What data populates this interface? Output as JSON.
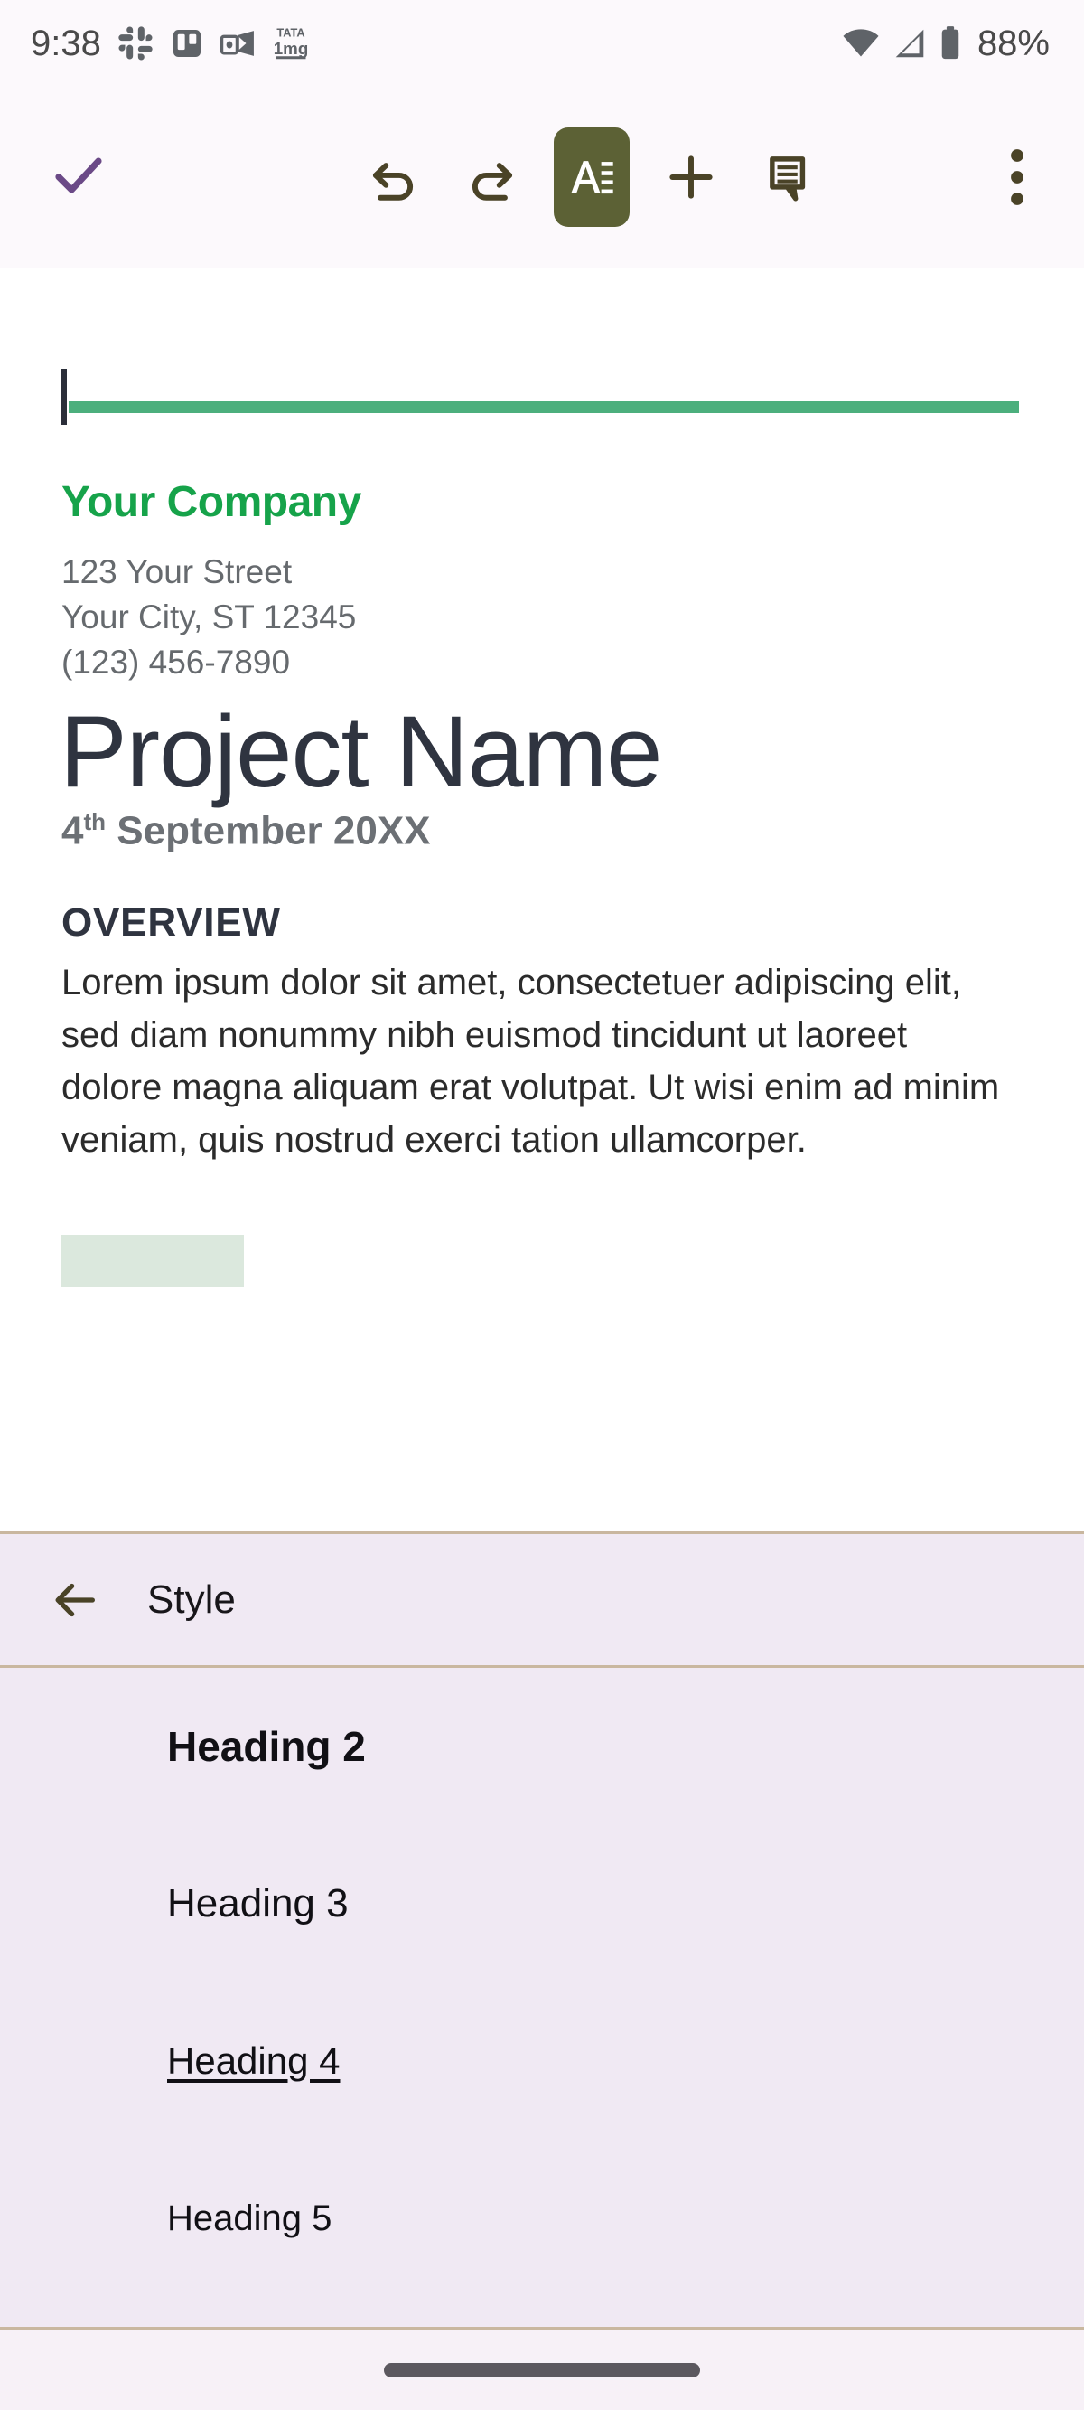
{
  "status_bar": {
    "time": "9:38",
    "battery_percent": "88%",
    "app_icons": [
      "slack-icon",
      "trello-icon",
      "outlook-icon",
      "tata-1mg-icon"
    ],
    "right_icons": [
      "wifi-icon",
      "cellular-signal-icon",
      "battery-icon"
    ]
  },
  "toolbar": {
    "done_label": "done-check",
    "undo_label": "undo",
    "redo_label": "redo",
    "format_label": "format-text",
    "add_label": "add",
    "comment_label": "comment",
    "more_label": "more-options",
    "accent_color": "#5c6135",
    "check_color": "#6b4a87",
    "icon_color": "#4a4327"
  },
  "document": {
    "rule_color": "#4caf7d",
    "company_name": "Your Company",
    "company_color": "#16a34a",
    "address_line_1": "123 Your Street",
    "address_line_2": "Your City, ST 12345",
    "address_line_3": "(123) 456-7890",
    "project_title": "Project Name",
    "date_day": "4",
    "date_ordinal": "th",
    "date_rest": " September 20XX",
    "section_heading": "OVERVIEW",
    "body_text": "Lorem ipsum dolor sit amet, consectetuer adipiscing elit, sed diam nonummy nibh euismod tincidunt ut laoreet dolore magna aliquam erat volutpat. Ut wisi enim ad minim veniam, quis nostrud exerci tation ullamcorper.",
    "highlight_color": "#dbe8dd"
  },
  "style_sheet": {
    "title": "Style",
    "back_label": "back",
    "background_color": "#f0e9f3",
    "items": [
      {
        "label": "Heading 2"
      },
      {
        "label": "Heading 3"
      },
      {
        "label": "Heading 4"
      },
      {
        "label": "Heading 5"
      }
    ]
  }
}
